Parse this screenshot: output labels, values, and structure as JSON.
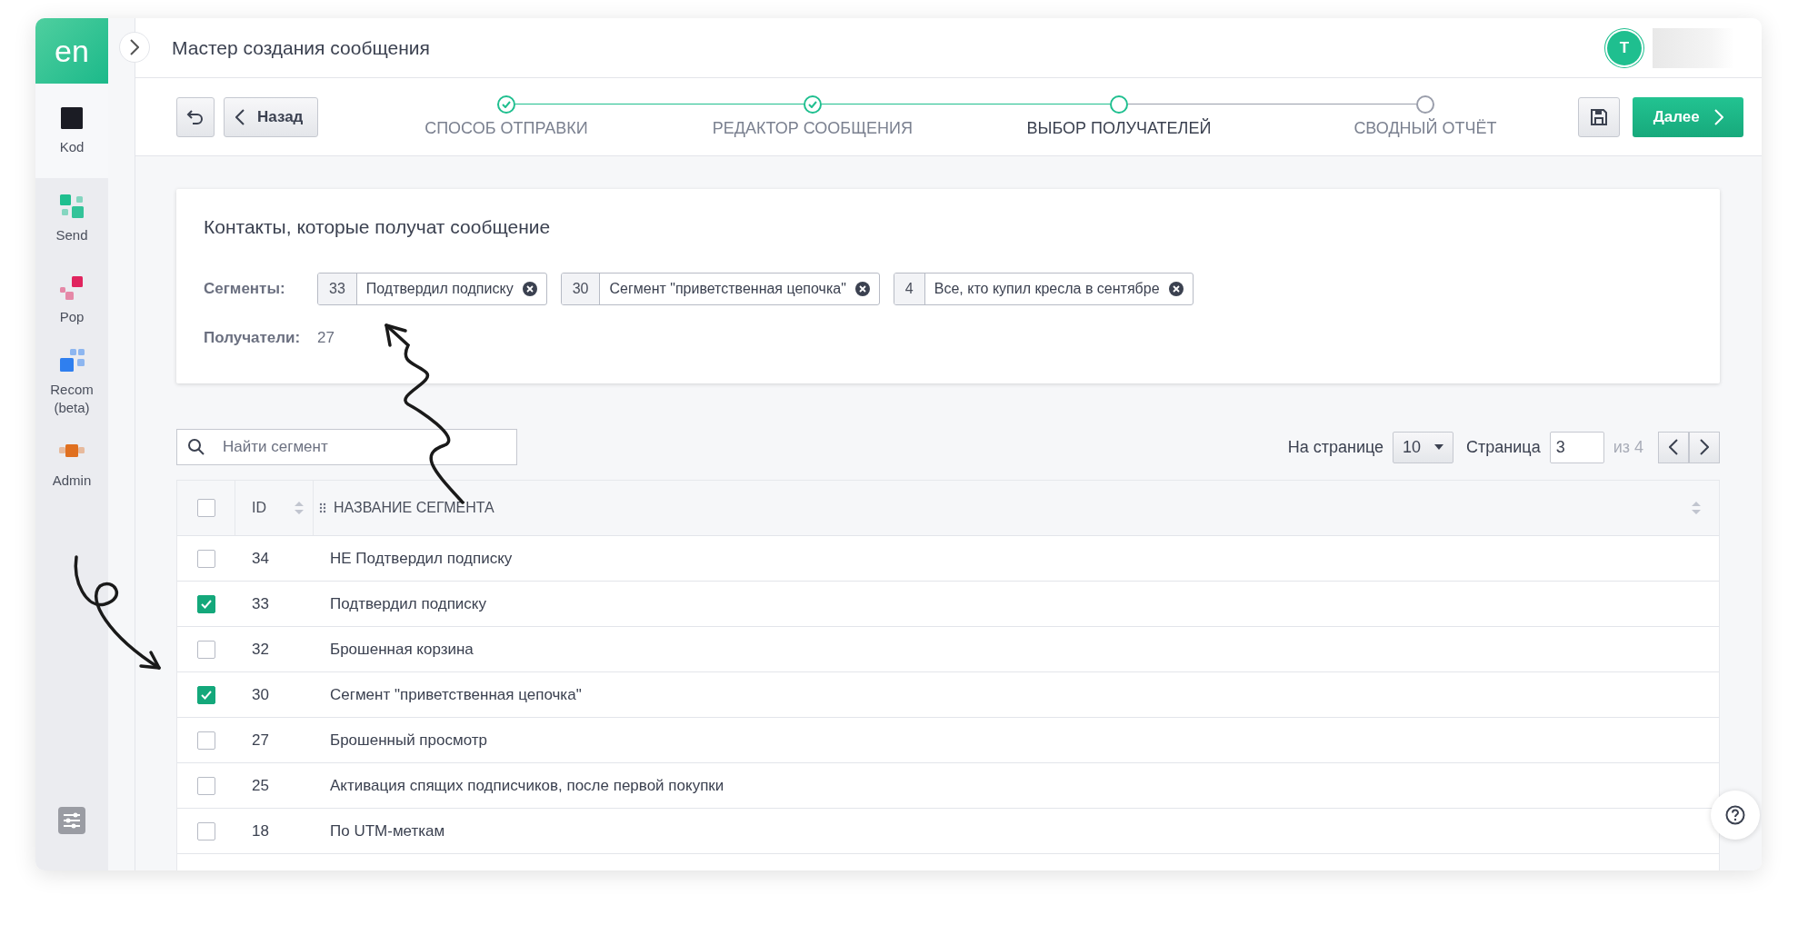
{
  "sidebar": {
    "logo": "en",
    "items": [
      {
        "label": "Kod",
        "selected": true,
        "color": "#1b1c24"
      },
      {
        "label": "Send",
        "selected": false,
        "color": "#1fbf8f"
      },
      {
        "label": "Pop",
        "selected": false,
        "color": "#e0245e"
      },
      {
        "label": "Recom (beta)",
        "selected": false,
        "color": "#2f7fef"
      },
      {
        "label": "Admin",
        "selected": false,
        "color": "#e07020"
      }
    ]
  },
  "header": {
    "title": "Мастер создания сообщения",
    "avatar": "T"
  },
  "toolbar": {
    "back": "Назад",
    "next": "Далее",
    "steps": [
      {
        "label": "СПОСОБ ОТПРАВКИ",
        "completed": true,
        "current": false
      },
      {
        "label": "РЕДАКТОР СООБЩЕНИЯ",
        "completed": true,
        "current": false
      },
      {
        "label": "ВЫБОР ПОЛУЧАТЕЛЕЙ",
        "completed": false,
        "current": true
      },
      {
        "label": "СВОДНЫЙ ОТЧЁТ",
        "completed": false,
        "current": false
      }
    ]
  },
  "recipients": {
    "title": "Контакты, которые получат сообщение",
    "segments_label": "Сегменты:",
    "segments": [
      {
        "id": "33",
        "name": "Подтвердил подписку"
      },
      {
        "id": "30",
        "name": "Сегмент \"приветственная цепочка\""
      },
      {
        "id": "4",
        "name": "Все, кто купил кресла в сентябре"
      }
    ],
    "recipients_label": "Получатели:",
    "recipients_count": "27"
  },
  "search": {
    "placeholder": "Найти сегмент"
  },
  "pagination": {
    "per_page_label": "На странице",
    "per_page": "10",
    "page_label": "Страница",
    "page": "3",
    "of": "из 4"
  },
  "table": {
    "select_all_checked": false,
    "columns": [
      "ID",
      "НАЗВАНИЕ СЕГМЕНТА"
    ],
    "rows": [
      {
        "id": "34",
        "name": "НЕ Подтвердил подписку",
        "checked": false
      },
      {
        "id": "33",
        "name": "Подтвердил подписку",
        "checked": true
      },
      {
        "id": "32",
        "name": "Брошенная корзина",
        "checked": false
      },
      {
        "id": "30",
        "name": "Сегмент \"приветственная цепочка\"",
        "checked": true
      },
      {
        "id": "27",
        "name": "Брошенный просмотр",
        "checked": false
      },
      {
        "id": "25",
        "name": "Активация спящих подписчиков, после первой покупки",
        "checked": false
      },
      {
        "id": "18",
        "name": "По UTM-меткам",
        "checked": false
      }
    ]
  }
}
